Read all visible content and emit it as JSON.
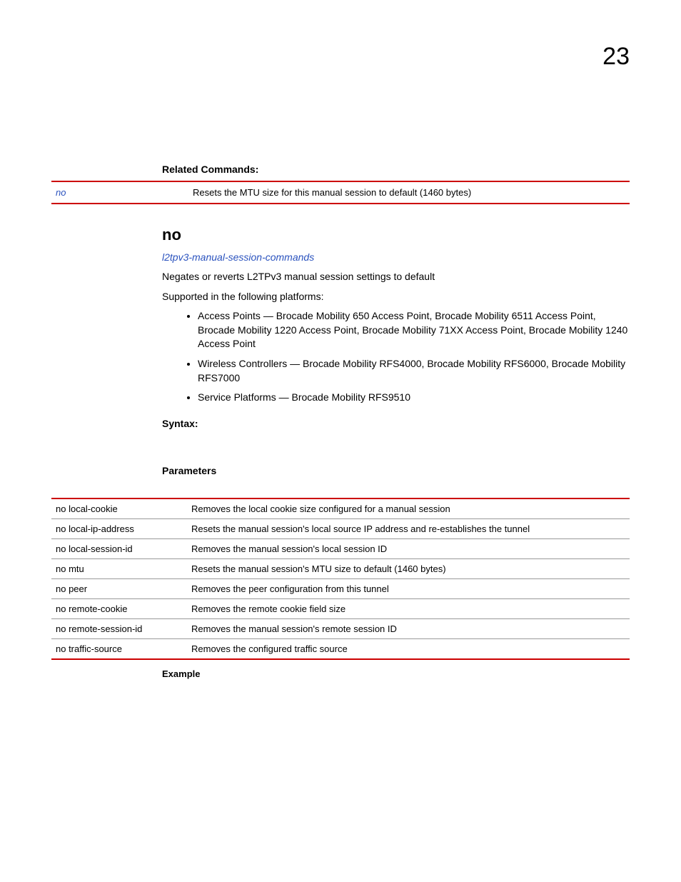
{
  "chapter_number": "23",
  "related_commands": {
    "heading": "Related Commands:",
    "rows": [
      {
        "cmd": "no",
        "desc": "Resets the MTU size for this manual session to default (1460 bytes)"
      }
    ]
  },
  "command": {
    "title": "no",
    "ref": "l2tpv3-manual-session-commands",
    "desc": "Negates or reverts L2TPv3 manual session settings to default",
    "support_intro": "Supported in the following platforms:",
    "bullets": [
      "Access Points — Brocade Mobility 650 Access Point, Brocade Mobility 6511 Access Point, Brocade Mobility 1220 Access Point, Brocade Mobility 71XX Access Point, Brocade Mobility 1240 Access Point",
      "Wireless Controllers — Brocade Mobility RFS4000, Brocade Mobility RFS6000, Brocade Mobility RFS7000",
      "Service Platforms — Brocade Mobility RFS9510"
    ],
    "syntax_heading": "Syntax:",
    "params_heading": "Parameters",
    "example_heading": "Example",
    "params": [
      {
        "name": "no local-cookie",
        "desc": "Removes the local cookie size configured for a manual session"
      },
      {
        "name": "no local-ip-address",
        "desc": "Resets the manual session's local source IP address and re-establishes the tunnel"
      },
      {
        "name": "no local-session-id",
        "desc": "Removes the manual session's local session ID"
      },
      {
        "name": "no mtu",
        "desc": "Resets the manual session's MTU size to default (1460 bytes)"
      },
      {
        "name": "no peer",
        "desc": "Removes the peer configuration from this tunnel"
      },
      {
        "name": "no remote-cookie",
        "desc": "Removes the remote cookie field size"
      },
      {
        "name": "no remote-session-id",
        "desc": "Removes the manual session's remote session ID"
      },
      {
        "name": "no traffic-source",
        "desc": "Removes the configured traffic source"
      }
    ]
  }
}
